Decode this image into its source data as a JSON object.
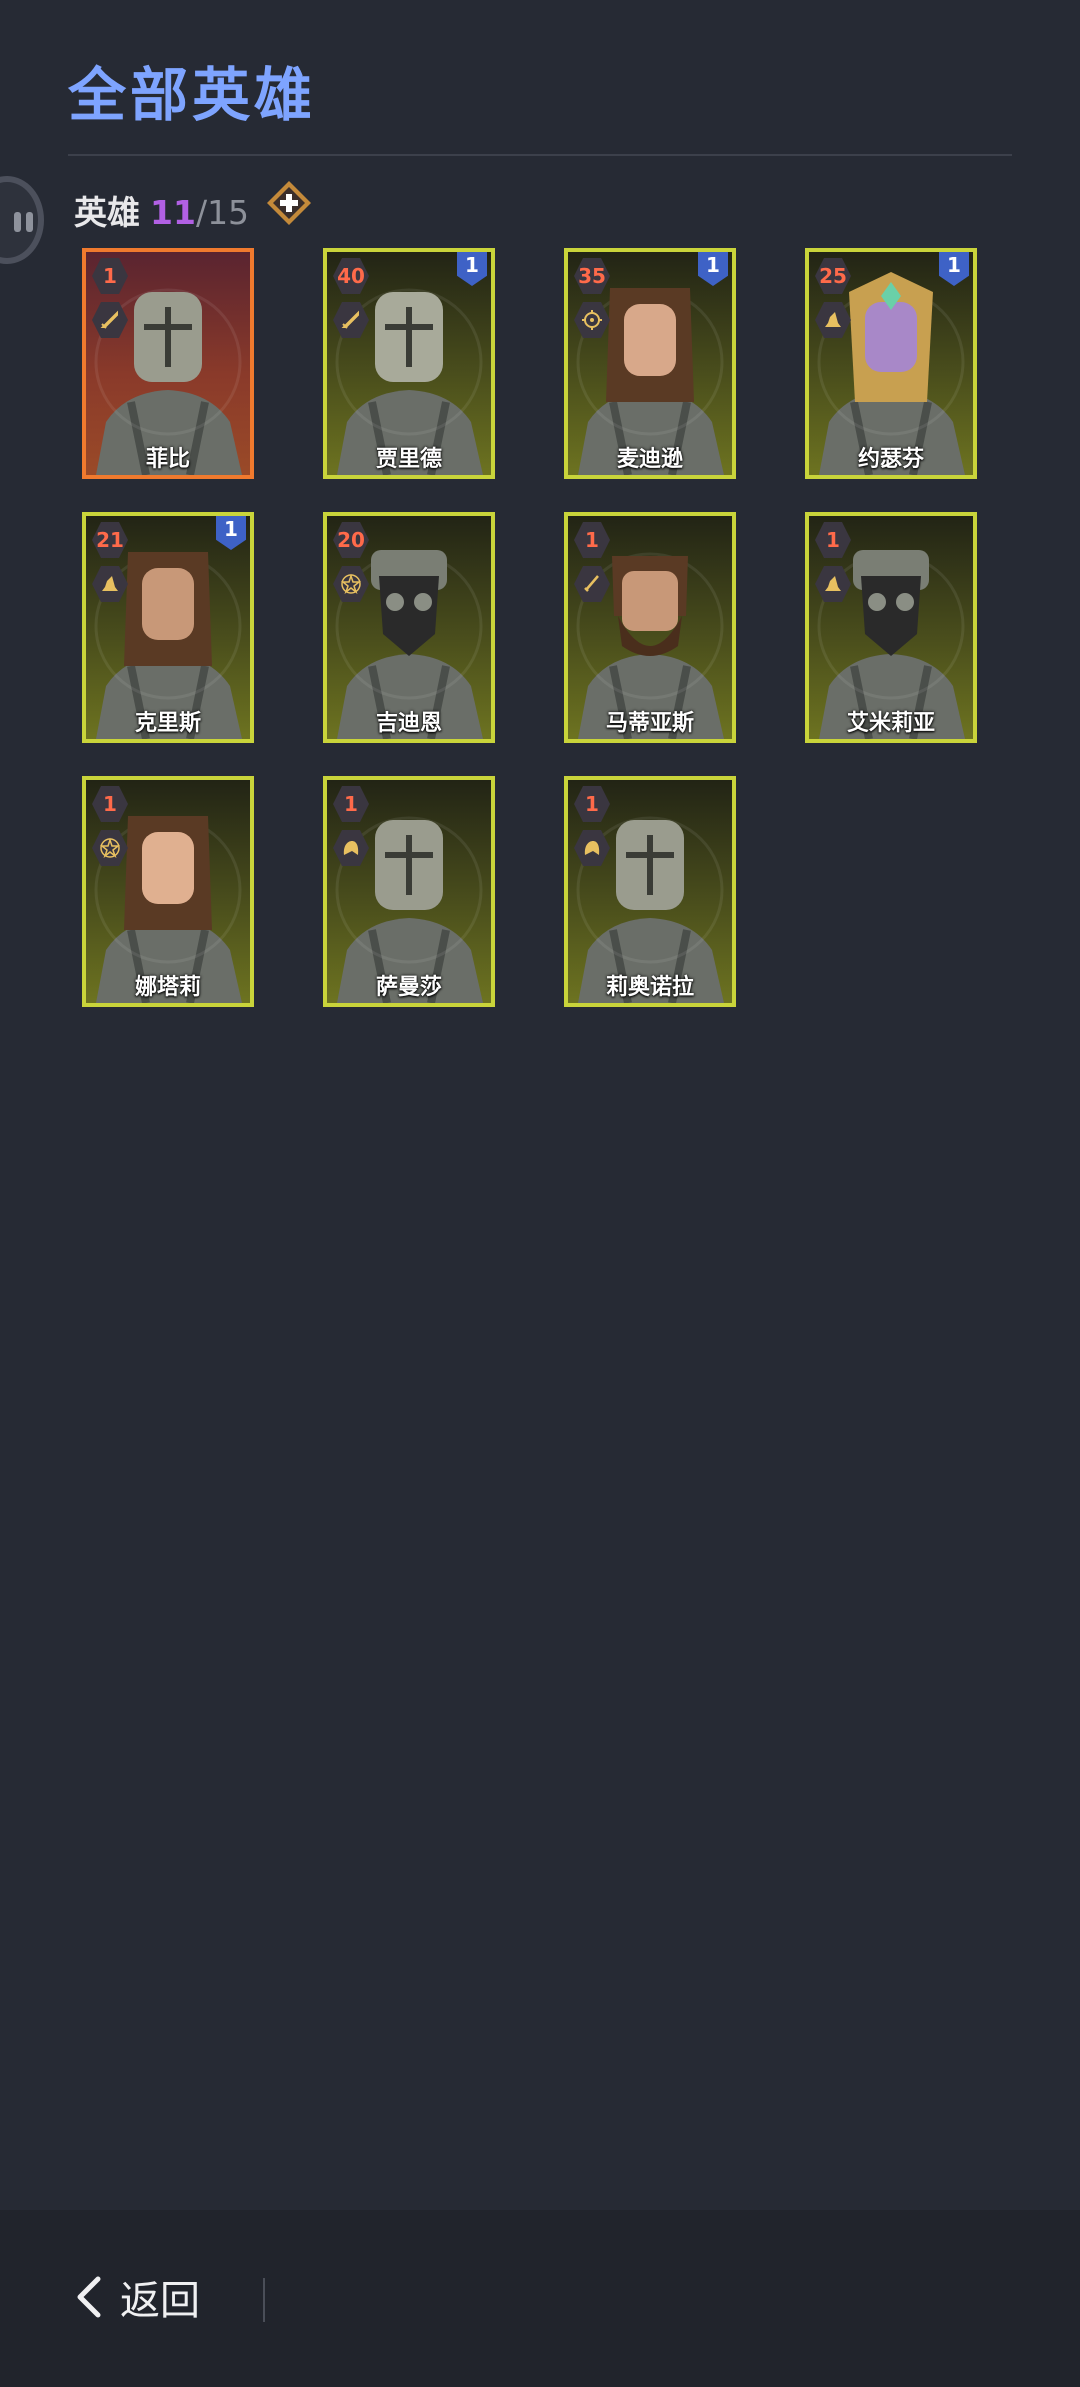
{
  "header": {
    "title": "全部英雄"
  },
  "hero_count": {
    "label": "英雄",
    "current": "11",
    "separator": "/",
    "max": "15"
  },
  "heroes": [
    {
      "name": "菲比",
      "level": "1",
      "class_icon": "sword-icon",
      "badge": "",
      "selected": true,
      "face": "helm",
      "accent": "#9a9c8e"
    },
    {
      "name": "贾里德",
      "level": "40",
      "class_icon": "sword-icon",
      "badge": "1",
      "selected": false,
      "face": "helm",
      "accent": "#a8aa9a"
    },
    {
      "name": "麦迪逊",
      "level": "35",
      "class_icon": "target-icon",
      "badge": "1",
      "selected": false,
      "face": "human",
      "accent": "#d8a88a"
    },
    {
      "name": "约瑟芬",
      "level": "25",
      "class_icon": "hat-icon",
      "badge": "1",
      "selected": false,
      "face": "elf",
      "accent": "#a888c8"
    },
    {
      "name": "克里斯",
      "level": "21",
      "class_icon": "hat-icon",
      "badge": "1",
      "selected": false,
      "face": "human",
      "accent": "#c89878"
    },
    {
      "name": "吉迪恩",
      "level": "20",
      "class_icon": "pentagram-icon",
      "badge": "",
      "selected": false,
      "face": "mask",
      "accent": "#2a2a2a"
    },
    {
      "name": "马蒂亚斯",
      "level": "1",
      "class_icon": "dagger-icon",
      "badge": "",
      "selected": false,
      "face": "beard",
      "accent": "#c89878"
    },
    {
      "name": "艾米莉亚",
      "level": "1",
      "class_icon": "hat-icon",
      "badge": "",
      "selected": false,
      "face": "mask",
      "accent": "#2a2a2a"
    },
    {
      "name": "娜塔莉",
      "level": "1",
      "class_icon": "pentagram-icon",
      "badge": "",
      "selected": false,
      "face": "human",
      "accent": "#e0b090"
    },
    {
      "name": "萨曼莎",
      "level": "1",
      "class_icon": "helmet-icon",
      "badge": "",
      "selected": false,
      "face": "helm",
      "accent": "#9a9c8e"
    },
    {
      "name": "莉奥诺拉",
      "level": "1",
      "class_icon": "helmet-icon",
      "badge": "",
      "selected": false,
      "face": "helm",
      "accent": "#9a9c8e"
    }
  ],
  "footer": {
    "back_label": "返回"
  },
  "colors": {
    "accent": "#7ea4ff",
    "card_border": "#c9d43a",
    "selected_border": "#f07a2e",
    "level_text": "#ff6a4a",
    "badge": "#3e62c6"
  }
}
